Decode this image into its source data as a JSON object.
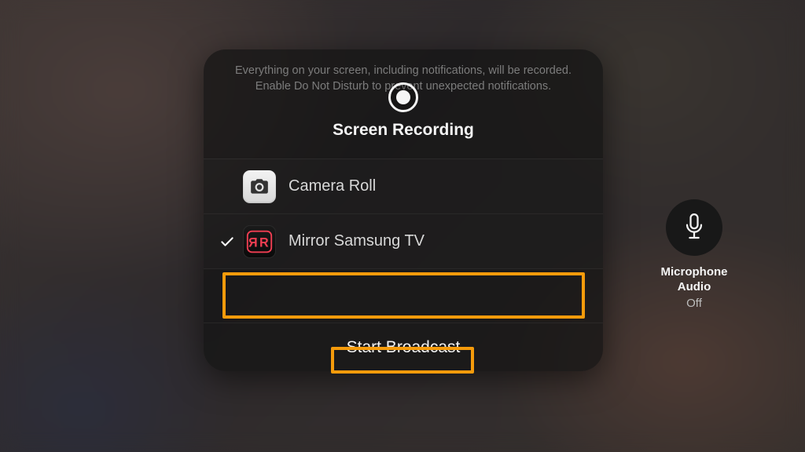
{
  "panel": {
    "disclaimer": "Everything on your screen, including notifications, will be recorded. Enable Do Not Disturb to prevent unexpected notifications.",
    "title": "Screen Recording",
    "start_label": "Start Broadcast"
  },
  "destinations": [
    {
      "key": "camera-roll",
      "label": "Camera Roll",
      "selected": false
    },
    {
      "key": "mirror-samsung-tv",
      "label": "Mirror Samsung TV",
      "selected": true
    }
  ],
  "microphone": {
    "title_line1": "Microphone",
    "title_line2": "Audio",
    "state": "Off"
  },
  "colors": {
    "highlight": "#f59b0b",
    "mirror_icon_accent": "#ef3e52"
  }
}
